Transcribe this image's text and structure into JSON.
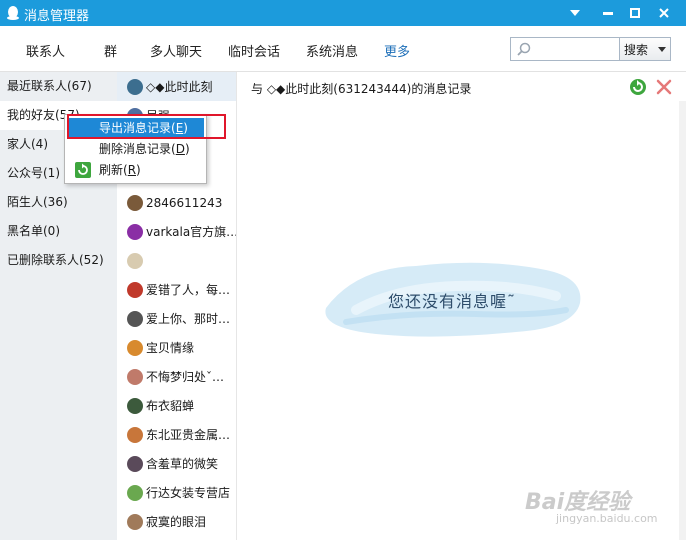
{
  "window": {
    "title": "消息管理器",
    "logo_icon": "qq-penguin-icon",
    "accent": "#1c9bdc"
  },
  "tabs": [
    {
      "label": "联系人"
    },
    {
      "label": "群"
    },
    {
      "label": "多人聊天"
    },
    {
      "label": "临时会话"
    },
    {
      "label": "系统消息"
    },
    {
      "label": "更多",
      "active": true
    }
  ],
  "search": {
    "placeholder": "",
    "button_label": "搜索"
  },
  "categories": [
    {
      "label": "最近联系人(67)"
    },
    {
      "label": "我的好友(57)",
      "selected": true
    },
    {
      "label": "家人(4)"
    },
    {
      "label": "公众号(1)"
    },
    {
      "label": "陌生人(36)"
    },
    {
      "label": "黑名单(0)"
    },
    {
      "label": "已删除联系人(52)"
    }
  ],
  "contacts": [
    {
      "name": "◇◆此时此刻",
      "selected": true,
      "color": "#3c6e8f"
    },
    {
      "name": "吴强",
      "color": "#4f6fa0"
    },
    {
      "name": "",
      "color": "#cccccc"
    },
    {
      "name": "",
      "color": "#cccccc"
    },
    {
      "name": "2846611243",
      "color": "#7a5a3a"
    },
    {
      "name": "varkala官方旗…",
      "color": "#8a2ea5",
      "badge": "VAR"
    },
    {
      "name": "",
      "color": "#d8cbb0"
    },
    {
      "name": "爱错了人，每…",
      "color": "#c0392b"
    },
    {
      "name": "爱上你、那时…",
      "color": "#555555"
    },
    {
      "name": "宝贝情缘",
      "color": "#d88a2e"
    },
    {
      "name": "不悔梦归处ˇ…",
      "color": "#c07a6a"
    },
    {
      "name": "布衣貂蝉",
      "color": "#3c5a3c"
    },
    {
      "name": "东北亚贵金属…",
      "color": "#c8763a"
    },
    {
      "name": "含羞草的微笑",
      "color": "#5a4a5a"
    },
    {
      "name": "行达女装专营店",
      "color": "#6aa84f"
    },
    {
      "name": "寂寞的眼泪",
      "color": "#a07a5a"
    }
  ],
  "message": {
    "header_title": "与 ◇◆此时此刻(631243444)的消息记录",
    "empty_text": "您还没有消息喔˜",
    "refresh_icon": "refresh-icon",
    "delete_icon": "delete-icon"
  },
  "context_menu": {
    "items": [
      {
        "label": "导出消息记录(",
        "key": "E",
        "highlight": true
      },
      {
        "label": "删除消息记录(",
        "key": "D"
      },
      {
        "label": "刷新(",
        "key": "R",
        "icon": "refresh-icon"
      }
    ]
  },
  "watermark": {
    "text": "Bai度经验",
    "url": "jingyan.baidu.com"
  }
}
